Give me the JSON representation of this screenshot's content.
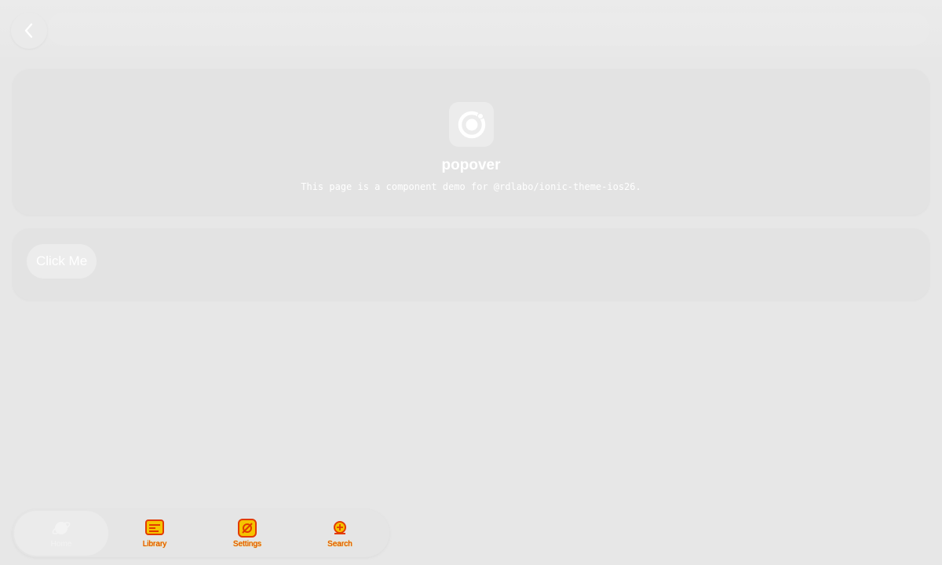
{
  "header": {
    "back_icon": "chevron-left-icon"
  },
  "hero": {
    "logo_icon": "ionic-logo-icon",
    "title": "popover",
    "description": "This page is a component demo for @rdlabo/ionic-theme-ios26."
  },
  "content": {
    "button_label": "Click Me"
  },
  "tabs": [
    {
      "label": "Home",
      "icon": "planet-icon",
      "active": true
    },
    {
      "label": "Library",
      "icon": "library-icon",
      "active": false
    },
    {
      "label": "Settings",
      "icon": "settings-icon",
      "active": false
    },
    {
      "label": "Search",
      "icon": "search-icon",
      "active": false
    }
  ],
  "colors": {
    "background": "#e7e7e7",
    "card": "#e3e3e3",
    "text": "#ffffff",
    "inactive_tab_accent": "#e23b00",
    "inactive_tab_highlight": "#f5c400"
  }
}
